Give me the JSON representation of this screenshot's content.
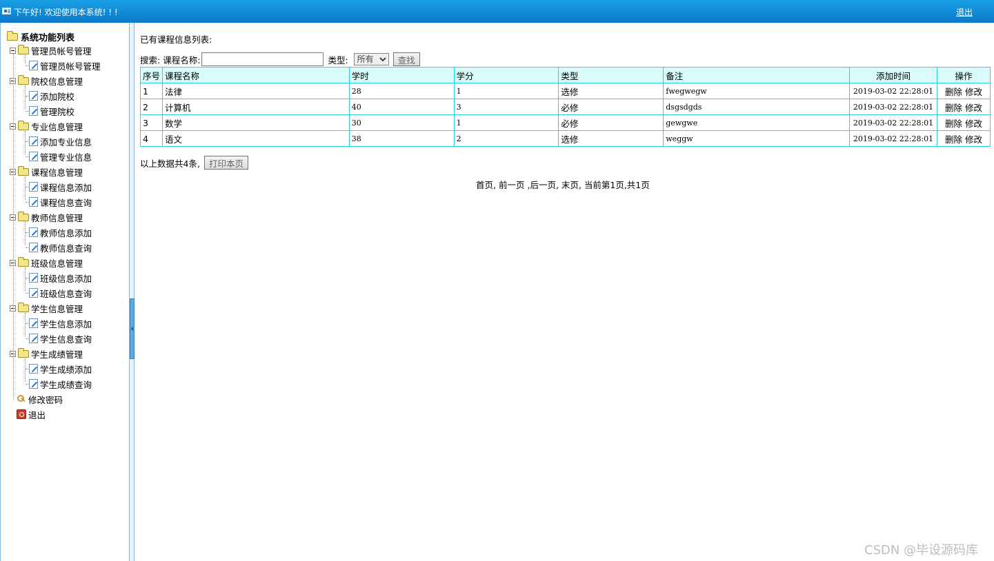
{
  "topbar": {
    "greeting": "下午好! 欢迎使用本系统! ! !",
    "logout": "退出"
  },
  "sidebar": {
    "root": "系统功能列表",
    "groups": [
      {
        "label": "管理员帐号管理",
        "items": [
          "管理员帐号管理"
        ]
      },
      {
        "label": "院校信息管理",
        "items": [
          "添加院校",
          "管理院校"
        ]
      },
      {
        "label": "专业信息管理",
        "items": [
          "添加专业信息",
          "管理专业信息"
        ]
      },
      {
        "label": "课程信息管理",
        "items": [
          "课程信息添加",
          "课程信息查询"
        ]
      },
      {
        "label": "教师信息管理",
        "items": [
          "教师信息添加",
          "教师信息查询"
        ]
      },
      {
        "label": "班级信息管理",
        "items": [
          "班级信息添加",
          "班级信息查询"
        ]
      },
      {
        "label": "学生信息管理",
        "items": [
          "学生信息添加",
          "学生信息查询"
        ]
      },
      {
        "label": "学生成绩管理",
        "items": [
          "学生成绩添加",
          "学生成绩查询"
        ]
      }
    ],
    "change_password": "修改密码",
    "logout": "退出"
  },
  "main": {
    "list_title": "已有课程信息列表:",
    "search": {
      "label": "搜索:",
      "name_label": "课程名称:",
      "name_value": "",
      "type_label": "类型:",
      "type_selected": "所有",
      "button": "查找"
    },
    "table": {
      "headers": [
        "序号",
        "课程名称",
        "学时",
        "学分",
        "类型",
        "备注",
        "添加时间",
        "操作"
      ],
      "rows": [
        {
          "no": "1",
          "name": "法律",
          "hours": "28",
          "credit": "1",
          "type": "选修",
          "note": "fwegwegw",
          "time": "2019-03-02 22:28:01"
        },
        {
          "no": "2",
          "name": "计算机",
          "hours": "40",
          "credit": "3",
          "type": "必修",
          "note": "dsgsdgds",
          "time": "2019-03-02 22:28:01"
        },
        {
          "no": "3",
          "name": "数学",
          "hours": "30",
          "credit": "1",
          "type": "必修",
          "note": "gewgwe",
          "time": "2019-03-02 22:28:01"
        },
        {
          "no": "4",
          "name": "语文",
          "hours": "38",
          "credit": "2",
          "type": "选修",
          "note": "weggw",
          "time": "2019-03-02 22:28:01"
        }
      ],
      "delete_label": "删除",
      "edit_label": "修改"
    },
    "summary": "以上数据共4条,",
    "print_button": "打印本页",
    "pager": {
      "first": "首页,",
      "prev": "前一页",
      "next": ",后一页,",
      "last": "末页,",
      "status": "当前第1页,共1页"
    }
  },
  "watermark": "CSDN @毕设源码库",
  "colors": {
    "topbar": "#0a8fdc",
    "table_border": "#24d5e0",
    "header_bg": "#d9fbfb"
  }
}
